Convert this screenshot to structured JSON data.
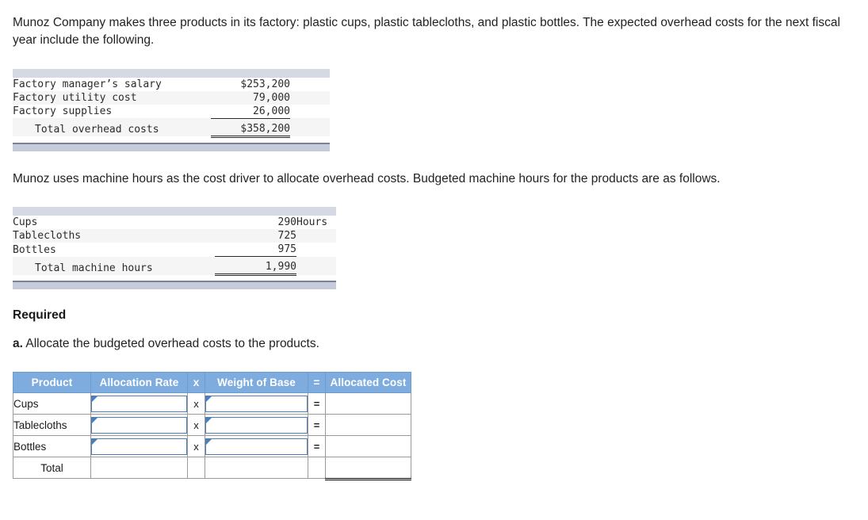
{
  "intro": {
    "paragraph": "Munoz Company makes three products in its factory: plastic cups, plastic tablecloths, and plastic bottles. The expected overhead costs for the next fiscal year include the following."
  },
  "overhead_table": {
    "rows": [
      {
        "label": "Factory manager’s salary",
        "value": "$253,200",
        "unit": ""
      },
      {
        "label": "Factory utility cost",
        "value": "79,000",
        "unit": ""
      },
      {
        "label": "Factory supplies",
        "value": "26,000",
        "unit": ""
      }
    ],
    "total": {
      "label": "Total overhead costs",
      "value": "$358,200",
      "unit": ""
    }
  },
  "mid": {
    "paragraph": "Munoz uses machine hours as the cost driver to allocate overhead costs. Budgeted machine hours for the products are as follows."
  },
  "hours_table": {
    "rows": [
      {
        "label": "Cups",
        "value": "290",
        "unit": "Hours"
      },
      {
        "label": "Tablecloths",
        "value": "725",
        "unit": ""
      },
      {
        "label": "Bottles",
        "value": "975",
        "unit": ""
      }
    ],
    "total": {
      "label": "Total machine hours",
      "value": "1,990",
      "unit": ""
    }
  },
  "required": {
    "heading": "Required",
    "item_a_marker": "a.",
    "item_a_text": " Allocate the budgeted overhead costs to the products."
  },
  "answer_table": {
    "headers": {
      "product": "Product",
      "allocation_rate": "Allocation Rate",
      "op_multiply": "x",
      "weight_of_base": "Weight of Base",
      "op_equals": "=",
      "allocated_cost": "Allocated Cost"
    },
    "rows": [
      {
        "product": "Cups",
        "rate": "",
        "op1": "x",
        "base": "",
        "op2": "=",
        "cost": ""
      },
      {
        "product": "Tablecloths",
        "rate": "",
        "op1": "x",
        "base": "",
        "op2": "=",
        "cost": ""
      },
      {
        "product": "Bottles",
        "rate": "",
        "op1": "x",
        "base": "",
        "op2": "=",
        "cost": ""
      }
    ],
    "total_row": {
      "product": "Total",
      "rate": "",
      "op1": "",
      "base": "",
      "op2": "",
      "cost": ""
    }
  },
  "colors": {
    "header_blue": "#7facde",
    "bar_top_gray": "#d4d9e4",
    "bar_bottom_gray": "#c5cbd9",
    "field_border_blue": "#4a7ebb",
    "row_alt": "#f5f5f5"
  }
}
